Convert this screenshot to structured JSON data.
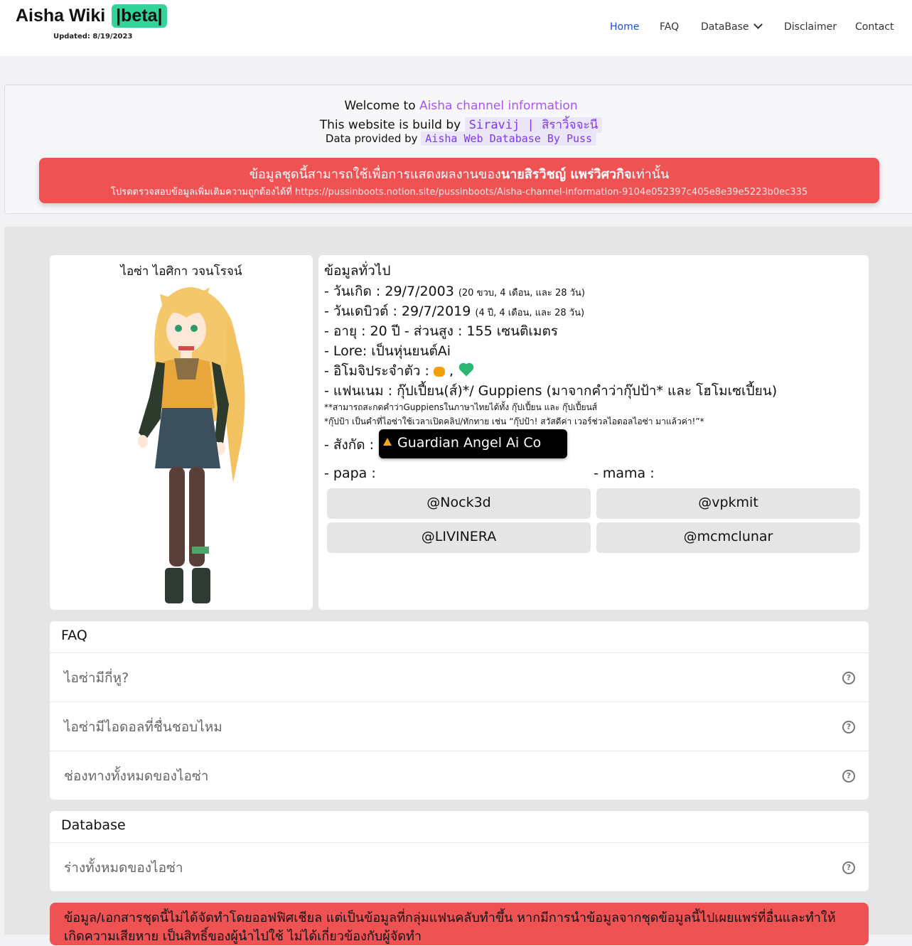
{
  "nav": {
    "logo_text": "Aisha Wiki",
    "badge": "|beta|",
    "updated": "Updated: 8/19/2023",
    "items": [
      {
        "label": "Home",
        "active": true
      },
      {
        "label": "FAQ"
      },
      {
        "label": "DataBase",
        "dropdown": true
      },
      {
        "label": "Disclaimer"
      },
      {
        "label": "Contact"
      }
    ]
  },
  "welcome": {
    "line1_prefix": "Welcome to ",
    "line1_highlight": "Aisha channel information",
    "line2_prefix": "This website is build by ",
    "line2_code": "Siravij | สิราวิ้จจะนี",
    "line3_prefix": "Data provided by ",
    "line3_code": "Aisha Web Database By Puss"
  },
  "alert": {
    "line1_prefix": "ข้อมูลชุดนี้สามารถใช้เพื่อการแสดงผลงานของ",
    "line1_bold": "นายสิรวิชญ์ แพร่วิศวกิจ",
    "line1_suffix": "เท่านั้น",
    "line2_prefix": "โปรดตรวจสอบข้อมูลเพิ่มเติมความถูกต้องได้ที่ ",
    "line2_url": "https://pussinboots.notion.site/pussinboots/Aisha-channel-information-9104e052397c405e8e39e5223b0ec335"
  },
  "profile": {
    "name": "ไอซ่า ไอศิกา วจนโรจน์"
  },
  "info": {
    "heading": "ข้อมูลทั่วไป",
    "birthday_label": "- วันเกิด : 29/7/2003",
    "birthday_age": "(20 ขวบ, 4 เดือน, และ 28 วัน)",
    "debut_label": "- วันเดบิวต์ : 29/7/2019",
    "debut_age": "(4 ปี, 4 เดือน, และ 28 วัน)",
    "age_height": "- อายุ : 20 ปี - ส่วนสูง : 155 เซนติเมตร",
    "lore": "- Lore: เป็นหุ่นยนต์Ai",
    "emoji_label": "- อิโมจิประจำตัว :",
    "emoji_sep": ",",
    "fanname": "- แฟนเนม : กุ๊ปเปี้ยน(ส์)*/ Guppiens (มาจากคำว่ากุ๊ปป้า* และ โฮโมเซเปี้ยน)",
    "note1": "**สามารถสะกดคำว่าGuppiensในภาษาไทยได้ทั้ง กุ๊ปเปี้ยน และ กุ๊ปเปี้ยนส์",
    "note2": "*กุ๊ปป้า เป็นคำที่ไอซ่าใช้เวลาเปิดคลิป/ทักทาย เช่น “กุ๊ปป้า! สวัสดีค่า เวอร์ช่วลไอดอลไอซ่า มาแล้วค่า!”*",
    "affiliation_label": "- สังกัด :",
    "affiliation": "Guardian Angel Ai Co Ltd.",
    "papa_label": "- papa :",
    "mama_label": "- mama :",
    "papa": [
      "@Nock3d",
      "@LIVINERA"
    ],
    "mama": [
      "@vpkmit",
      "@mcmclunar"
    ]
  },
  "faq": {
    "title": "FAQ",
    "items": [
      "ไอซ่ามีกี่หู?",
      "ไอซ่ามีไอดอลที่ชื่นชอบไหม",
      "ช่องทางทั้งหมดของไอซ่า"
    ]
  },
  "database": {
    "title": "Database",
    "items": [
      "ร่างทั้งหมดของไอซ่า"
    ]
  },
  "bottom_alert": {
    "text": "ข้อมูล/เอกสารชุดนี้ไม่ได้จัดทำโดยออฟฟิศเชียล แต่เป็นข้อมูลที่กลุ่มแฟนคลับทำขึ้น หากมีการนำข้อมูลจากชุดข้อมูลนี้ไปเผยแพร่ที่อื่นและทำให้เกิดความเสียหาย เป็นสิทธิ์ของผู้นำไปใช้ ไม่ได้เกี่ยวข้องกับผู้จัดทำ"
  },
  "colors": {
    "accent_green": "#34d399",
    "alert_red": "#ef5253",
    "nav_active": "#1d4ed8",
    "purple": "#a855f7"
  }
}
